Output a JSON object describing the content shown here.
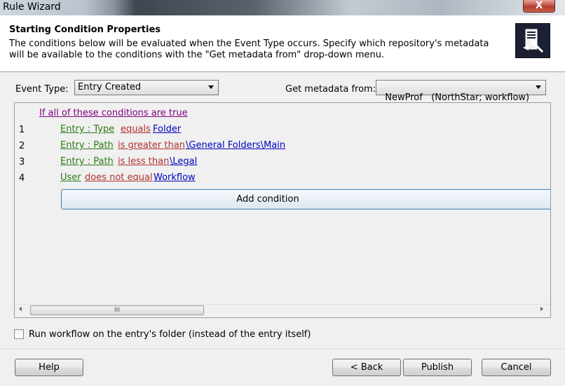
{
  "window": {
    "title": "Rule Wizard",
    "close_glyph": "X"
  },
  "header": {
    "title": "Starting Condition Properties",
    "description": "The conditions below will be evaluated when the Event Type occurs. Specify which repository's metadata will be available to the conditions with the \"Get metadata from\" drop-down menu.",
    "icon": "wizard-icon"
  },
  "event_type": {
    "label": "Event Type:",
    "value": "Entry Created"
  },
  "metadata": {
    "label": "Get metadata from:",
    "value": "NewProf   (NorthStar; workflow)"
  },
  "conditions": {
    "header": "If all of these conditions are true",
    "rows": [
      {
        "num": "1",
        "field": "Entry : Type",
        "op": "equals",
        "value": "Folder"
      },
      {
        "num": "2",
        "field": "Entry : Path",
        "op": "is greater than",
        "value": "\\General Folders\\Main"
      },
      {
        "num": "3",
        "field": "Entry : Path",
        "op": "is less than",
        "value": "\\Legal"
      },
      {
        "num": "4",
        "field": "User",
        "op": "does not equal",
        "value": "Workflow"
      }
    ],
    "add_label": "Add condition",
    "scroll_thumb_glyph": "III"
  },
  "options": {
    "run_on_folder_label": "Run workflow on the entry's folder (instead of the entry itself)",
    "run_on_folder_checked": false
  },
  "buttons": {
    "help": "Help",
    "back": "< Back",
    "publish": "Publish",
    "cancel": "Cancel"
  },
  "colors": {
    "header_link": "#800080",
    "field": "#2a7a12",
    "operator": "#b03030",
    "value": "#0000c0"
  }
}
